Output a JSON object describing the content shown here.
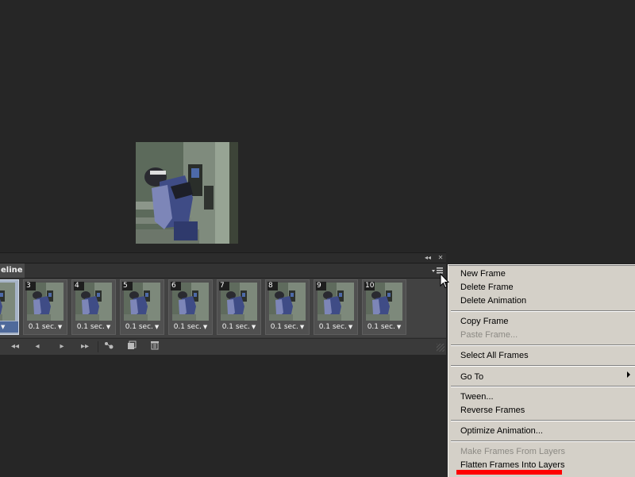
{
  "panel": {
    "tab_label": "eline",
    "topbar_collapse": "◂◂",
    "topbar_close": "✕",
    "menu_icon": "panel-menu-icon"
  },
  "frames": [
    {
      "number": "",
      "delay": "ec.",
      "selected": true
    },
    {
      "number": "3",
      "delay": "0.1 sec.",
      "selected": false
    },
    {
      "number": "4",
      "delay": "0.1 sec.",
      "selected": false
    },
    {
      "number": "5",
      "delay": "0.1 sec.",
      "selected": false
    },
    {
      "number": "6",
      "delay": "0.1 sec.",
      "selected": false
    },
    {
      "number": "7",
      "delay": "0.1 sec.",
      "selected": false
    },
    {
      "number": "8",
      "delay": "0.1 sec.",
      "selected": false
    },
    {
      "number": "9",
      "delay": "0.1 sec.",
      "selected": false
    },
    {
      "number": "10",
      "delay": "0.1 sec.",
      "selected": false
    }
  ],
  "controls": {
    "first_frame": "◂◂",
    "prev_frame": "◂",
    "play": "▸",
    "next_frame": "▸▸",
    "tween_icon": "tween-icon",
    "duplicate_icon": "duplicate-frame-icon",
    "delete_icon": "trash-icon"
  },
  "context_menu": {
    "items": [
      {
        "label": "New Frame",
        "enabled": true
      },
      {
        "label": "Delete Frame",
        "enabled": true
      },
      {
        "label": "Delete Animation",
        "enabled": true
      },
      {
        "label": "Copy Frame",
        "enabled": true
      },
      {
        "label": "Paste Frame...",
        "enabled": false
      },
      {
        "label": "Select All Frames",
        "enabled": true
      },
      {
        "label": "Go To",
        "enabled": true,
        "submenu": true
      },
      {
        "label": "Tween...",
        "enabled": true
      },
      {
        "label": "Reverse Frames",
        "enabled": true
      },
      {
        "label": "Optimize Animation...",
        "enabled": true
      },
      {
        "label": "Make Frames From Layers",
        "enabled": false
      },
      {
        "label": "Flatten Frames Into Layers",
        "enabled": true
      }
    ]
  },
  "colors": {
    "workspace_bg": "#262626",
    "panel_bg": "#3a3a3a",
    "menu_bg": "#d4d0c8",
    "highlight_underline": "#ff0000",
    "selected_frame": "#a6b3c6"
  }
}
